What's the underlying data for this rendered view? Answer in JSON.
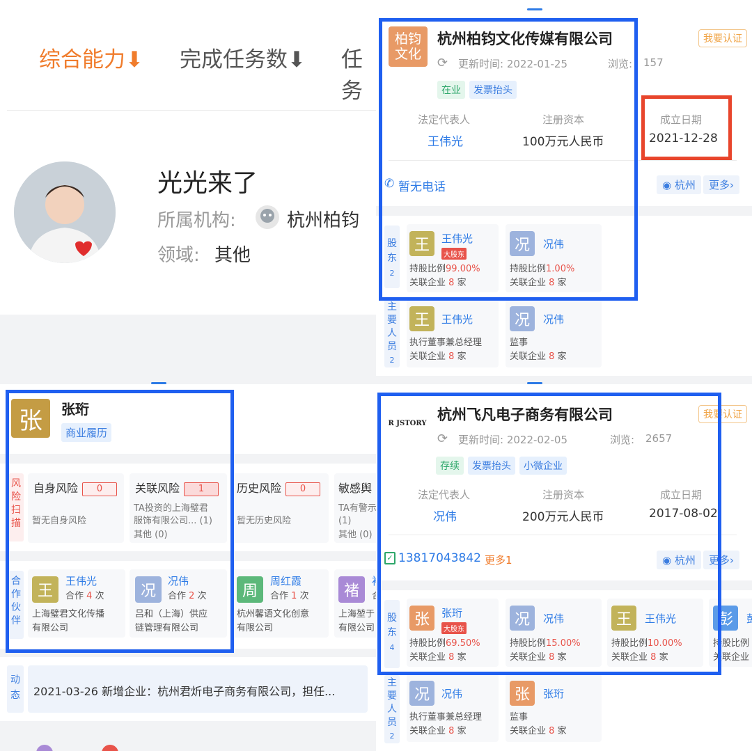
{
  "tl": {
    "sort_tabs": [
      "综合能力⬇",
      "完成任务数⬇",
      "任务"
    ],
    "profile_name": "光光来了",
    "org_label": "所属机构:",
    "org_value": "杭州柏钧",
    "field_label": "领域:",
    "field_value": "其他"
  },
  "tr": {
    "logo_text": "柏钧文化",
    "company": "杭州柏钧文化传媒有限公司",
    "certify": "我要认证",
    "update": "更新时间: 2022-01-25",
    "views_label": "浏览:",
    "views": "157",
    "tags": [
      "在业",
      "发票抬头"
    ],
    "legal_label": "法定代表人",
    "legal_value": "王伟光",
    "capital_label": "注册资本",
    "capital_value": "100万元人民币",
    "date_label": "成立日期",
    "date_value": "2021-12-28",
    "phone": "暂无电话",
    "location": "杭州",
    "more": "更多",
    "shareholder_side": "股东",
    "shareholder_count": "2",
    "shareholders": [
      {
        "avatar": "王",
        "name": "王伟光",
        "badge": "大股东",
        "ratio_label": "持股比例",
        "ratio": "99.00%",
        "assoc_label": "关联企业",
        "assoc": "8",
        "unit": "家"
      },
      {
        "avatar": "况",
        "name": "况伟",
        "badge": "",
        "ratio_label": "持股比例",
        "ratio": "1.00%",
        "assoc_label": "关联企业",
        "assoc": "8",
        "unit": "家"
      }
    ],
    "staff_side": "主要人员",
    "staff_count": "2",
    "staff": [
      {
        "avatar": "王",
        "name": "王伟光",
        "role": "执行董事兼总经理",
        "assoc_label": "关联企业",
        "assoc": "8",
        "unit": "家"
      },
      {
        "avatar": "况",
        "name": "况伟",
        "role": "监事",
        "assoc_label": "关联企业",
        "assoc": "8",
        "unit": "家"
      }
    ]
  },
  "bl": {
    "avatar": "张",
    "name": "张珩",
    "tag": "商业履历",
    "risk_side": "风险扫描",
    "risks": [
      {
        "title": "自身风险",
        "count": "0",
        "lines": [
          "暂无自身风险"
        ]
      },
      {
        "title": "关联风险",
        "count": "1",
        "lines": [
          "TA投资的上海璧君",
          "服饰有限公司... (1)",
          "其他 (0)"
        ]
      },
      {
        "title": "历史风险",
        "count": "0",
        "lines": [
          "暂无历史风险"
        ]
      },
      {
        "title": "敏感舆",
        "count": "",
        "lines": [
          "TA有警示",
          "(1)",
          "其他 (0)"
        ]
      }
    ],
    "partner_side": "合作伙伴",
    "partners": [
      {
        "avatar": "王",
        "name": "王伟光",
        "coop_label": "合作",
        "coop": "4",
        "unit": "次",
        "company": [
          "上海璧君文化传播",
          "有限公司"
        ]
      },
      {
        "avatar": "况",
        "name": "况伟",
        "coop_label": "合作",
        "coop": "2",
        "unit": "次",
        "company": [
          "吕和（上海）供应",
          "链管理有限公司"
        ]
      },
      {
        "avatar": "周",
        "name": "周红霞",
        "coop_label": "合作",
        "coop": "1",
        "unit": "次",
        "company": [
          "杭州馨语文化创意",
          "有限公司"
        ]
      },
      {
        "avatar": "褚",
        "name": "褚",
        "coop_label": "合",
        "coop": "",
        "unit": "",
        "company": [
          "上海堃于",
          "有限公司"
        ]
      }
    ],
    "news_side": "动态",
    "news": "2021-03-26 新增企业：杭州君炘电子商务有限公司，担任..."
  },
  "br": {
    "logo_text": "R JSTORY",
    "company": "杭州飞凡电子商务有限公司",
    "certify": "我要认证",
    "update": "更新时间: 2022-02-05",
    "views_label": "浏览:",
    "views": "2657",
    "tags": [
      "存续",
      "发票抬头",
      "小微企业"
    ],
    "legal_label": "法定代表人",
    "legal_value": "况伟",
    "capital_label": "注册资本",
    "capital_value": "200万元人民币",
    "date_label": "成立日期",
    "date_value": "2017-08-02",
    "phone": "13817043842",
    "phone_more": "更多1",
    "location": "杭州",
    "more": "更多",
    "shareholder_side": "股东",
    "shareholder_count": "4",
    "shareholders": [
      {
        "avatar": "张",
        "name": "张珩",
        "badge": "大股东",
        "ratio_label": "持股比例",
        "ratio": "69.50%",
        "assoc_label": "关联企业",
        "assoc": "8",
        "unit": "家"
      },
      {
        "avatar": "况",
        "name": "况伟",
        "badge": "",
        "ratio_label": "持股比例",
        "ratio": "15.00%",
        "assoc_label": "关联企业",
        "assoc": "8",
        "unit": "家"
      },
      {
        "avatar": "王",
        "name": "王伟光",
        "badge": "",
        "ratio_label": "持股比例",
        "ratio": "10.00%",
        "assoc_label": "关联企业",
        "assoc": "8",
        "unit": "家"
      },
      {
        "avatar": "彭",
        "name": "彭",
        "badge": "",
        "ratio_label": "持股比例",
        "ratio": "",
        "assoc_label": "关联企业",
        "assoc": "",
        "unit": ""
      }
    ],
    "staff_side": "主要人员",
    "staff_count": "2",
    "staff": [
      {
        "avatar": "况",
        "name": "况伟",
        "role": "执行董事兼总经理",
        "assoc_label": "关联企业",
        "assoc": "8",
        "unit": "家"
      },
      {
        "avatar": "张",
        "name": "张珩",
        "role": "监事",
        "assoc_label": "关联企业",
        "assoc": "8",
        "unit": "家"
      }
    ]
  },
  "colors": {
    "highlight_blue": "#1f5ff0",
    "highlight_red": "#e8452c",
    "accent_orange": "#f07c2c",
    "link_blue": "#2e7be6"
  }
}
